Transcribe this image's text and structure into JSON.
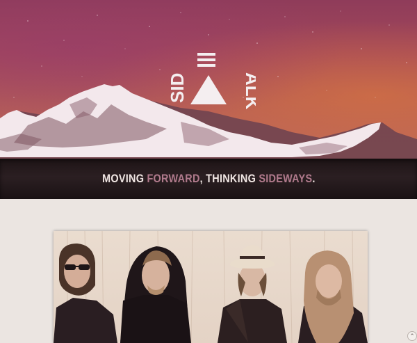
{
  "brand": {
    "logo_text_left": "SID",
    "logo_text_right": "ALK"
  },
  "tagline": {
    "part1": "MOVING ",
    "part2": "FORWARD",
    "part3": ", THINKING ",
    "part4": "SIDEWAYS",
    "part5": "."
  },
  "colors": {
    "accent": "#b07a8c",
    "bar_dark": "#1e1416",
    "page_bg": "#ebe5e1"
  },
  "icons": {
    "scroll_top": "chevron-up-icon"
  }
}
